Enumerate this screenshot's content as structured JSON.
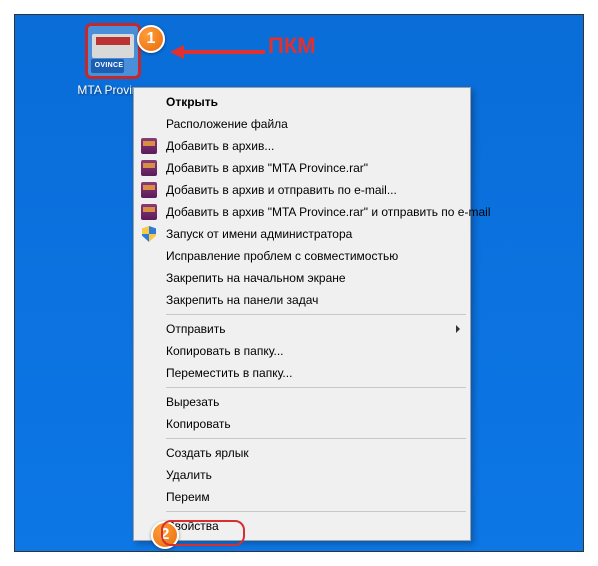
{
  "desktop": {
    "icon_label": "MTA Provin...",
    "icon_badge_text": "OVINCE"
  },
  "annotation": {
    "label": "ПКМ",
    "badge1": "1",
    "badge2": "2"
  },
  "menu": {
    "open": "Открыть",
    "file_location": "Расположение файла",
    "add_to_archive": "Добавить в архив...",
    "add_to_named": "Добавить в архив \"MTA Province.rar\"",
    "add_and_email": "Добавить в архив и отправить по e-mail...",
    "add_named_email": "Добавить в архив \"MTA Province.rar\" и отправить по e-mail",
    "run_as_admin": "Запуск от имени администратора",
    "troubleshoot": "Исправление проблем с совместимостью",
    "pin_start": "Закрепить на начальном экране",
    "pin_taskbar": "Закрепить на панели задач",
    "send_to": "Отправить",
    "copy_to_folder": "Копировать в папку...",
    "move_to_folder": "Переместить в папку...",
    "cut": "Вырезать",
    "copy": "Копировать",
    "create_shortcut": "Создать ярлык",
    "delete": "Удалить",
    "rename": "Переим",
    "properties": "Свойства"
  }
}
